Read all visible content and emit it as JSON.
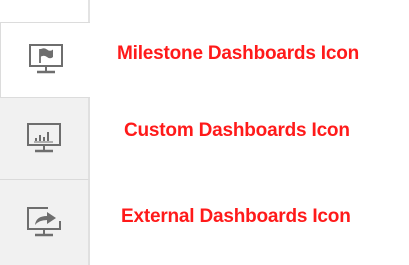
{
  "tabs": [
    {
      "icon": "milestone-dashboard-icon",
      "selected": true
    },
    {
      "icon": "custom-dashboard-icon",
      "selected": false
    },
    {
      "icon": "external-dashboard-icon",
      "selected": false
    }
  ],
  "captions": {
    "milestone": "Milestone Dashboards Icon",
    "custom": "Custom Dashboards Icon",
    "external": "External Dashboards Icon"
  },
  "colors": {
    "caption": "#ff1a1a",
    "icon_stroke": "#6e6e6e",
    "selected_tab_bg": "#ffffff",
    "unselected_tab_bg": "#f1f1f1"
  }
}
